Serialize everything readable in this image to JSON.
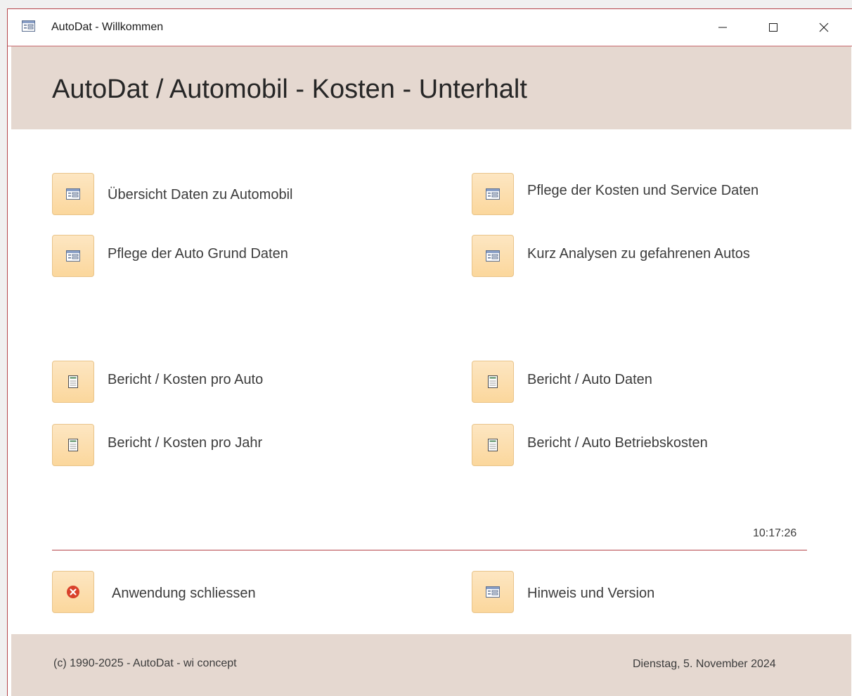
{
  "window": {
    "title": "AutoDat - Willkommen",
    "icon": "form-icon"
  },
  "header": {
    "title": "AutoDat / Automobil - Kosten - Unterhalt"
  },
  "menu": {
    "uebersicht": "Übersicht Daten zu Automobil",
    "pflege_auto": "Pflege der Auto Grund Daten",
    "pflege_kosten": "Pflege der Kosten und Service Daten",
    "kurz_analysen": "Kurz Analysen zu gefahrenen Autos",
    "bericht_kosten_auto": "Bericht / Kosten pro Auto",
    "bericht_kosten_jahr": "Bericht / Kosten pro Jahr",
    "bericht_auto_daten": "Bericht / Auto Daten",
    "bericht_betriebskosten": "Bericht / Auto Betriebskosten"
  },
  "time": "10:17:26",
  "bottom": {
    "close_app": "Anwendung schliessen",
    "hinweis": "Hinweis und Version"
  },
  "footer": {
    "copyright": "(c) 1990-2025 - AutoDat - wi concept",
    "date": "Dienstag, 5. November 2024"
  },
  "colors": {
    "accent_border": "#b5454a",
    "band": "#e5d8d0",
    "button_fill": "#fbd79c",
    "close_red": "#d9412b"
  }
}
